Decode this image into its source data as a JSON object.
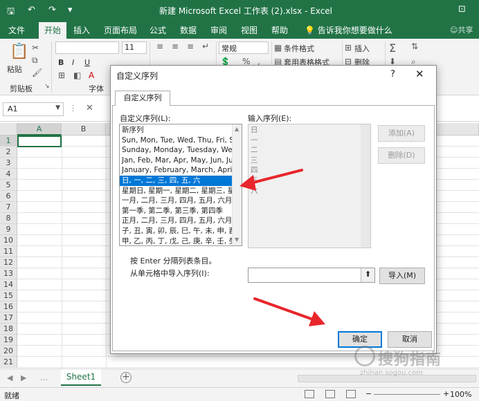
{
  "window": {
    "title": "新建 Microsoft Excel 工作表 (2).xlsx  -  Excel"
  },
  "ribbon_tabs": [
    "文件",
    "开始",
    "插入",
    "页面布局",
    "公式",
    "数据",
    "审阅",
    "视图",
    "帮助"
  ],
  "active_tab": "开始",
  "tell_me": "告诉我你想要做什么",
  "share": "共享",
  "ribbon": {
    "paste": "粘贴",
    "clipboard": "剪贴板",
    "font_group": "字体",
    "font_size": "11",
    "number_format": "常规",
    "conditional_format": "条件格式",
    "table_format": "套用表格格式",
    "insert": "插入",
    "delete": "删除",
    "bold": "B",
    "italic": "I",
    "underline": "U"
  },
  "formula_bar": {
    "name_box": "A1"
  },
  "grid": {
    "columns": [
      "A",
      "B"
    ],
    "rows": [
      "1",
      "2",
      "3",
      "4",
      "5",
      "6",
      "7",
      "8",
      "9",
      "10",
      "11",
      "12",
      "13",
      "14",
      "15",
      "16",
      "17",
      "18",
      "19",
      "20",
      "21"
    ]
  },
  "sheet_tabs": [
    "Sheet1"
  ],
  "status": {
    "ready": "就绪",
    "zoom": "100%"
  },
  "dialog": {
    "title": "自定义序列",
    "help": "?",
    "close": "✕",
    "tab": "自定义序列",
    "custom_lists_label": "自定义序列(L):",
    "entries_label": "输入序列(E):",
    "custom_lists": [
      "新序列",
      "Sun, Mon, Tue, Wed, Thu, Fri, S",
      "Sunday, Monday, Tuesday, Wec",
      "Jan, Feb, Mar, Apr, May, Jun, Ju",
      "January, February, March, April",
      "日, 一, 二, 三, 四, 五, 六",
      "星期日, 星期一, 星期二, 星期三, 星",
      "一月, 二月, 三月, 四月, 五月, 六月,",
      "第一季, 第二季, 第三季, 第四季",
      "正月, 二月, 三月, 四月, 五月, 六月,",
      "子, 丑, 寅, 卯, 辰, 巳, 午, 未, 申, 酉",
      "甲, 乙, 丙, 丁, 戊, 己, 庚, 辛, 壬, 癸"
    ],
    "selected_index": 5,
    "entries": [
      "日",
      "一",
      "二",
      "三",
      "四",
      "五",
      "六"
    ],
    "add_button": "添加(A)",
    "delete_button": "删除(D)",
    "hint": "按 Enter 分隔列表条目。",
    "import_label": "从单元格中导入序列(I):",
    "import_button": "导入(M)",
    "ok_button": "确定",
    "cancel_button": "取消"
  },
  "watermark": {
    "text": "搜狗指南",
    "url": "zhinan.sogou.com"
  },
  "colors": {
    "excel_green": "#217346",
    "selection_blue": "#0078d7",
    "arrow_red": "#e8262b"
  }
}
